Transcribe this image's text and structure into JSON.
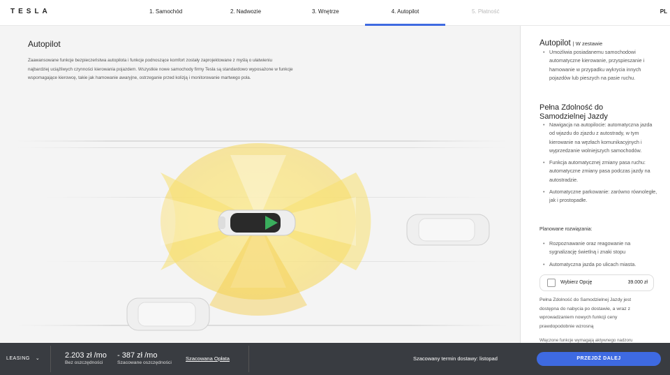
{
  "header": {
    "logo": "TESLA",
    "steps": [
      {
        "label": "1. Samochód"
      },
      {
        "label": "2. Nadwozie"
      },
      {
        "label": "3. Wnętrze"
      },
      {
        "label": "4. Autopilot"
      },
      {
        "label": "5. Płatność"
      }
    ],
    "language": "PL"
  },
  "main": {
    "title": "Autopilot",
    "description": "Zaawansowane funkcje bezpieczeństwa autopilota i funkcje podnoszące komfort zostały zaprojektowane z myślą o ułatwieniu najbardziej uciążliwych czynności kierowania pojazdem. Wszystkie nowe samochody firmy Tesla są standardowo wyposażone w funkcje wspomagające kierowcę, takie jak hamowanie awaryjne, ostrzeganie przed kolizją i monitorowanie martwego pola."
  },
  "side": {
    "autopilot_title": "Autopilot",
    "autopilot_sub": "| W zestawie",
    "autopilot_items": [
      "Umożliwia posiadanemu samochodowi automatyczne kierowanie, przyspieszanie i hamowanie w przypadku wykrycia innych pojazdów lub pieszych na pasie ruchu."
    ],
    "fsd_title": "Pełna Zdolność do Samodzielnej Jazdy",
    "fsd_items": [
      "Nawigacja na autopilocie: automatyczna jazda od wjazdu do zjazdu z autostrady, w tym kierowanie na węzłach komunikacyjnych i wyprzedzanie wolniejszych samochodów.",
      "Funkcja automatycznej zmiany pasa ruchu: automatyczne zmiany pasa podczas jazdy na autostradzie.",
      "Automatyczne parkowanie: zarówno równoległe, jak i prostopadłe."
    ],
    "planned_label": "Planowane rozwiązania:",
    "planned_items": [
      "Rozpoznawanie oraz reagowanie na sygnalizację świetlną i znaki stopu",
      "Automatyczna jazda po ulicach miasta."
    ],
    "option_label": "Wybierz Opcję",
    "option_price": "39.000 zł",
    "note": "Pełna Zdolność do Samodzielnej Jazdy jest dostępna do nabycia po dostawie, a wraz z wprowadzaniem nowych funkcji ceny prawdopodobnie wzrosną",
    "note2": "Włączone funkcje wymagają aktywnego nadzoru"
  },
  "footer": {
    "leasing": "LEASING",
    "price1": "2.203 zł /mo",
    "price1_sub": "Bez oszczędności",
    "price2": "- 387 zł /mo",
    "price2_sub": "Szacowane oszczędności",
    "fee_link": "Szacowana Opłata",
    "delivery": "Szacowany termin dostawy: listopad",
    "cta": "PRZEJDŹ DALEJ"
  },
  "colors": {
    "accent": "#3e6ae1",
    "footer_bg": "#393c41",
    "sensor_yellow": "#f7dd4a"
  }
}
